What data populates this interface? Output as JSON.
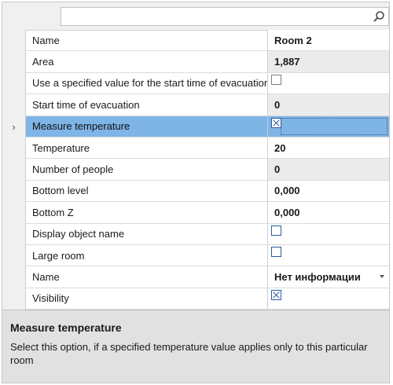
{
  "search": {
    "placeholder": ""
  },
  "properties": [
    {
      "name": "Name",
      "value": "Room 2",
      "type": "text"
    },
    {
      "name": "Area",
      "value": "1,887",
      "type": "readonly"
    },
    {
      "name": "Use a specified value for the start time of evacuation",
      "checked": false,
      "type": "checkbox",
      "style": "gray"
    },
    {
      "name": "Start time of evacuation",
      "value": "0",
      "type": "readonly"
    },
    {
      "name": "Measure temperature",
      "checked": true,
      "type": "checkbox",
      "selected": true,
      "indicator": "›"
    },
    {
      "name": "Temperature",
      "value": "20",
      "type": "text"
    },
    {
      "name": "Number of people",
      "value": "0",
      "type": "readonly"
    },
    {
      "name": "Bottom level",
      "value": "0,000",
      "type": "text"
    },
    {
      "name": "Bottom Z",
      "value": "0,000",
      "type": "text"
    },
    {
      "name": "Display object name",
      "checked": false,
      "type": "checkbox"
    },
    {
      "name": "Large room",
      "checked": false,
      "type": "checkbox"
    },
    {
      "name": "Name",
      "value": "Нет информации",
      "type": "dropdown"
    },
    {
      "name": "Visibility",
      "checked": true,
      "type": "checkbox"
    }
  ],
  "description": {
    "title": "Measure temperature",
    "text": "Select this option, if a specified temperature value applies only to this particular room"
  },
  "colors": {
    "selection": "#7eb4e6",
    "checkbox_border": "#2a5aa0",
    "readonly_bg": "#ebebeb"
  },
  "icons": {
    "search": "magnifier-icon",
    "dropdown": "chevron-down-icon",
    "row_indicator": "chevron-right-icon"
  }
}
